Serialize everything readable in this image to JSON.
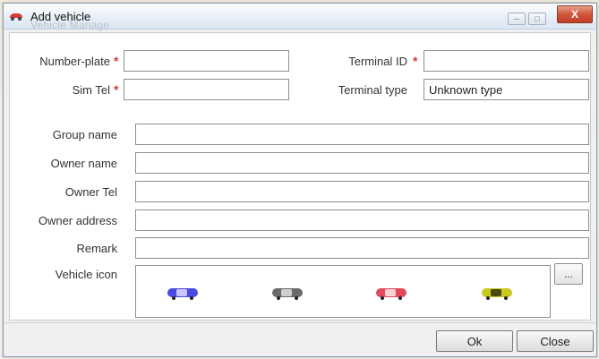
{
  "window": {
    "title": "Add vehicle",
    "background_title": "Vehicle Manage"
  },
  "form": {
    "number_plate": {
      "label": "Number-plate",
      "required_mark": "*",
      "value": ""
    },
    "terminal_id": {
      "label": "Terminal ID",
      "required_mark": "*",
      "value": ""
    },
    "sim_tel": {
      "label": "Sim Tel",
      "required_mark": "*",
      "value": ""
    },
    "terminal_type": {
      "label": "Terminal type",
      "value": "Unknown type"
    },
    "group_name": {
      "label": "Group name",
      "value": ""
    },
    "owner_name": {
      "label": "Owner name",
      "value": ""
    },
    "owner_tel": {
      "label": "Owner Tel",
      "value": ""
    },
    "owner_address": {
      "label": "Owner address",
      "value": ""
    },
    "remark": {
      "label": "Remark",
      "value": ""
    },
    "vehicle_icon": {
      "label": "Vehicle icon",
      "options": [
        {
          "name": "car-blue-icon",
          "color": "#4a4ae0"
        },
        {
          "name": "car-gray-icon",
          "color": "#6a6a6a"
        },
        {
          "name": "car-red-icon",
          "color": "#e04a5a"
        },
        {
          "name": "car-yellow-icon",
          "color": "#c8c820"
        }
      ],
      "browse_label": "..."
    }
  },
  "buttons": {
    "ok": "Ok",
    "close": "Close"
  },
  "colors": {
    "required": "#d23b3b",
    "close_button": "#c23d24"
  }
}
